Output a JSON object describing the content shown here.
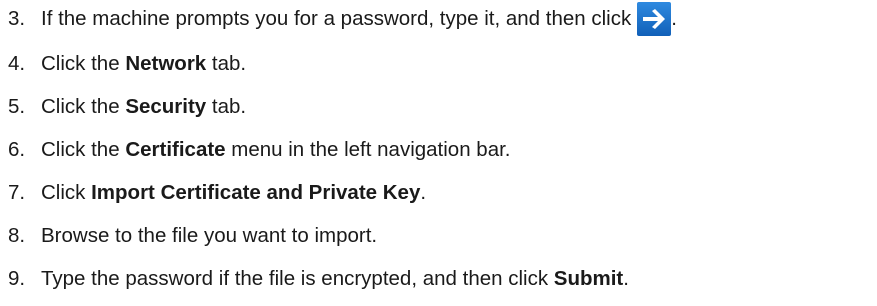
{
  "steps": [
    {
      "number": "3.",
      "before": "If the machine prompts you for a password, type it, and then click ",
      "bold": "",
      "after": ".",
      "icon": "arrow-right-icon"
    },
    {
      "number": "4.",
      "before": "Click the ",
      "bold": "Network",
      "after": " tab."
    },
    {
      "number": "5.",
      "before": "Click the ",
      "bold": "Security",
      "after": " tab."
    },
    {
      "number": "6.",
      "before": "Click the ",
      "bold": "Certificate",
      "after": " menu in the left navigation bar."
    },
    {
      "number": "7.",
      "before": "Click ",
      "bold": "Import Certificate and Private Key",
      "after": "."
    },
    {
      "number": "8.",
      "before": "Browse to the file you want to import.",
      "bold": "",
      "after": ""
    },
    {
      "number": "9.",
      "before": "Type the password if the file is encrypted, and then click ",
      "bold": "Submit",
      "after": "."
    }
  ],
  "colors": {
    "arrow_button_top": "#2f8ae0",
    "arrow_button_bottom": "#1160b8",
    "arrow_glyph": "#ffffff"
  }
}
